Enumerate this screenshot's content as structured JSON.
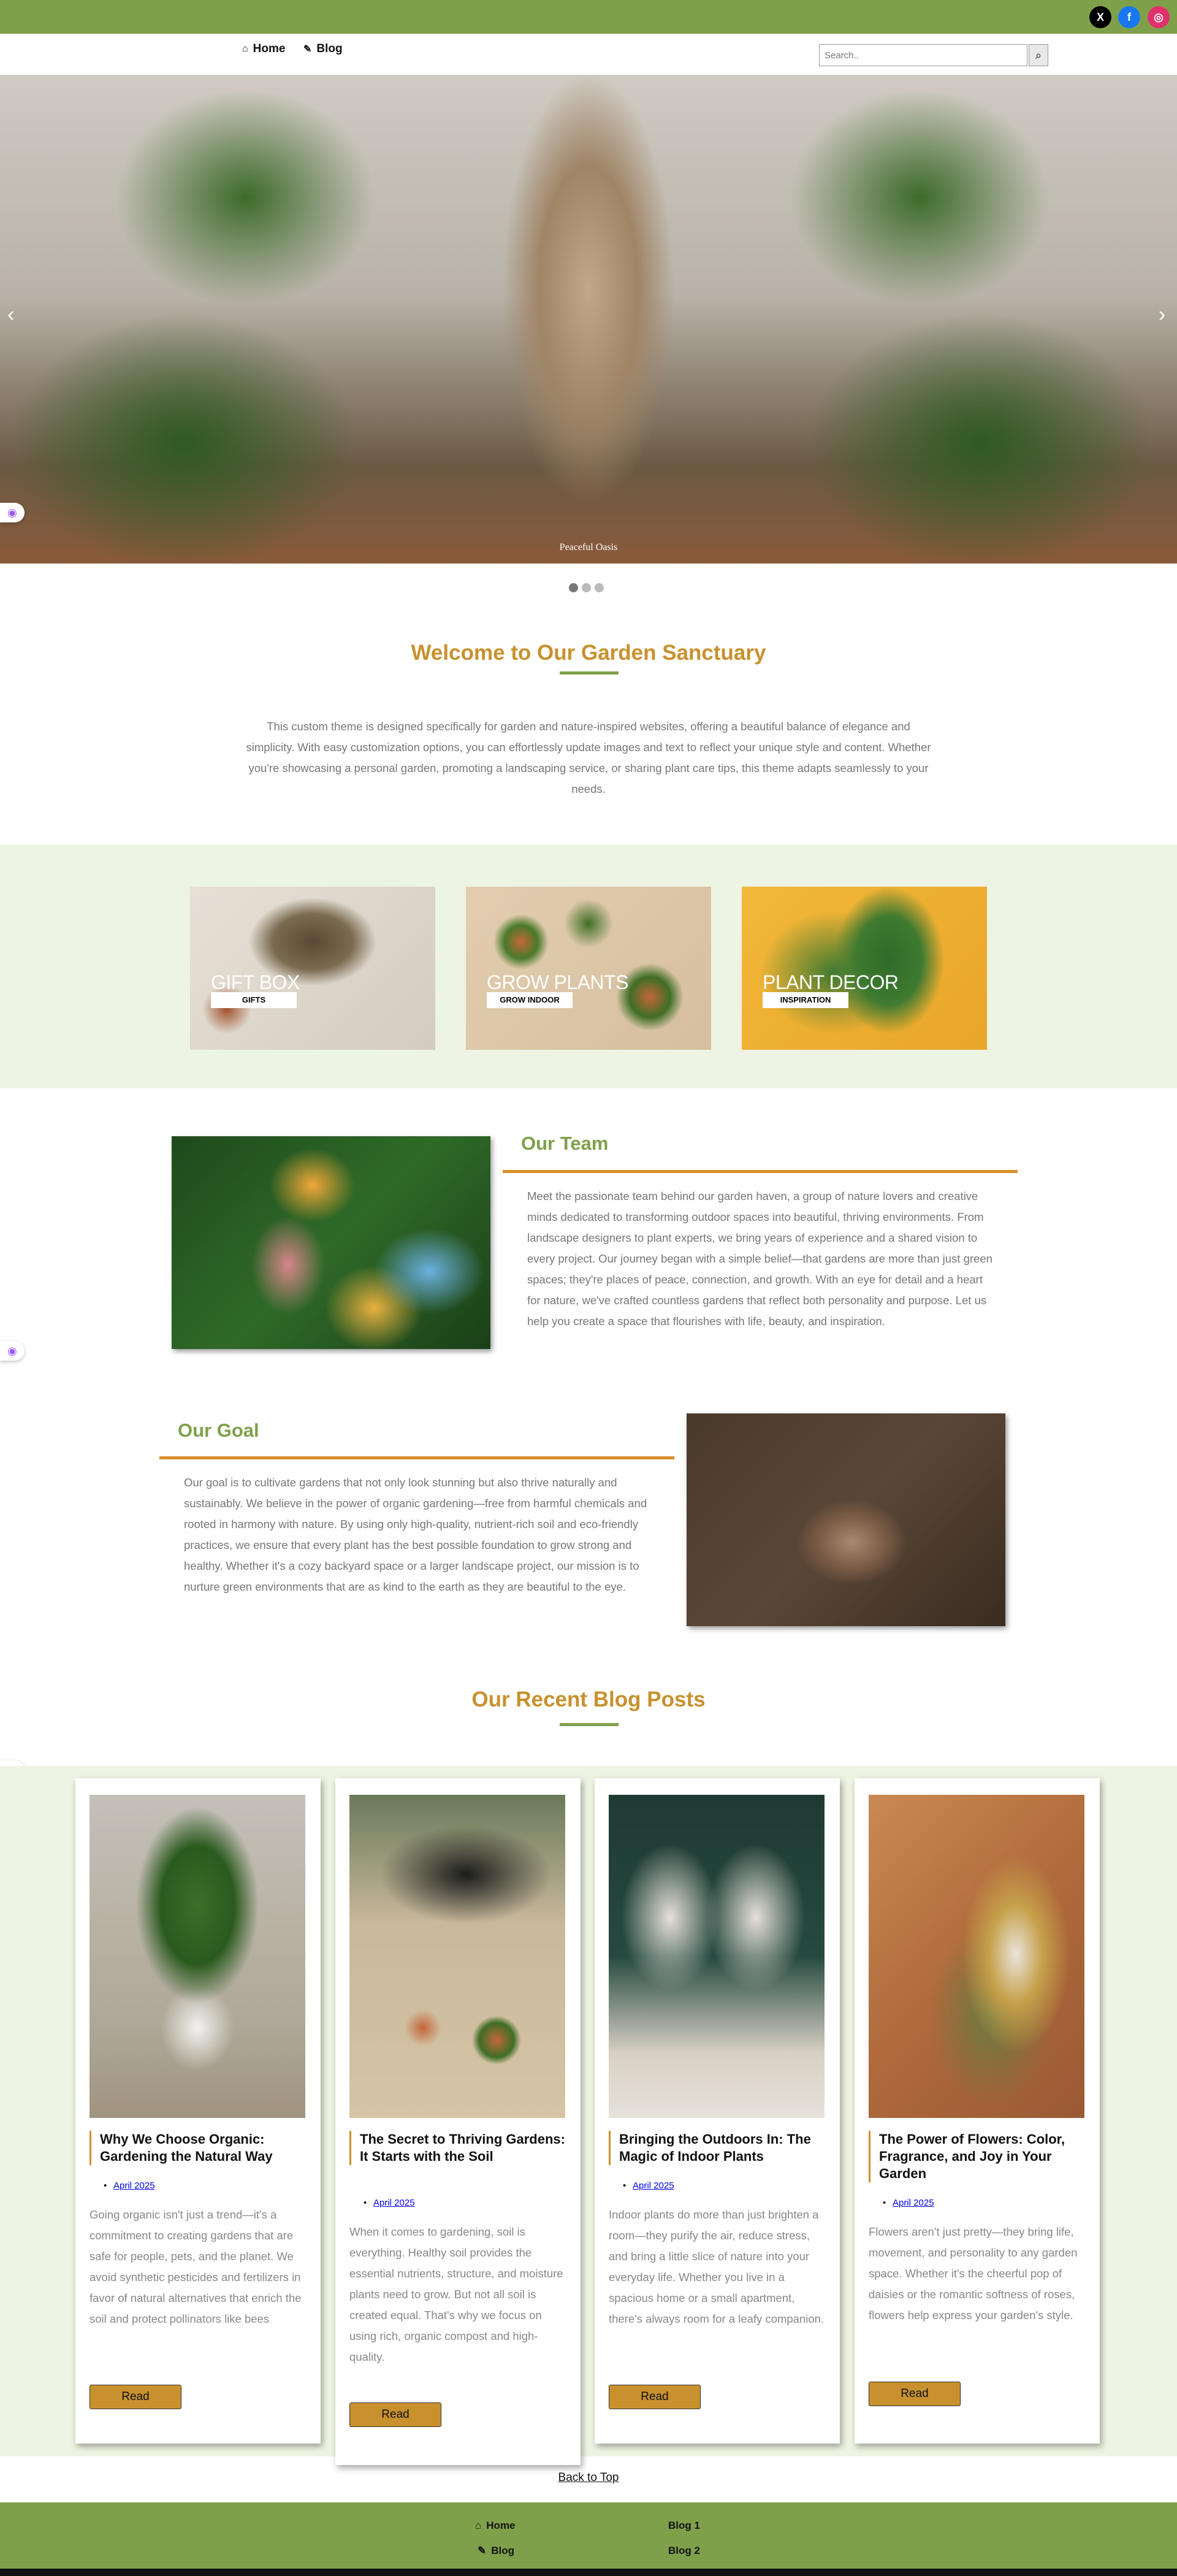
{
  "social": {
    "x": "X",
    "facebook": "f",
    "instagram": "◎"
  },
  "nav": {
    "home": "Home",
    "blog": "Blog",
    "home_icon": "⌂",
    "blog_icon": "✎"
  },
  "search": {
    "placeholder": "Search..",
    "icon": "⌕"
  },
  "hero": {
    "caption": "Peaceful Oasis",
    "prev": "‹",
    "next": "›"
  },
  "welcome": {
    "title": "Welcome to Our Garden Sanctuary",
    "text": "This custom theme is designed specifically for garden and nature-inspired websites, offering a beautiful balance of elegance and simplicity. With easy customization options, you can effortlessly update images and text to reflect your unique style and content. Whether you're showcasing a personal garden, promoting a landscaping service, or sharing plant care tips, this theme adapts seamlessly to your needs."
  },
  "categories": [
    {
      "title": "GIFT BOX",
      "subtitle": "GIFTS"
    },
    {
      "title": "GROW PLANTS",
      "subtitle": "GROW INDOOR"
    },
    {
      "title": "PLANT DECOR",
      "subtitle": "INSPIRATION"
    }
  ],
  "team": {
    "title": "Our Team",
    "text": "Meet the passionate team behind our garden haven, a group of nature lovers and creative minds dedicated to transforming outdoor spaces into beautiful, thriving environments. From landscape designers to plant experts, we bring years of experience and a shared vision to every project. Our journey began with a simple belief—that gardens are more than just green spaces; they're places of peace, connection, and growth. With an eye for detail and a heart for nature, we've crafted countless gardens that reflect both personality and purpose. Let us help you create a space that flourishes with life, beauty, and inspiration."
  },
  "goal": {
    "title": "Our Goal",
    "text": "Our goal is to cultivate gardens that not only look stunning but also thrive naturally and sustainably. We believe in the power of organic gardening—free from harmful chemicals and rooted in harmony with nature. By using only high-quality, nutrient-rich soil and eco-friendly practices, we ensure that every plant has the best possible foundation to grow strong and healthy. Whether it's a cozy backyard space or a larger landscape project, our mission is to nurture green environments that are as kind to the earth as they are beautiful to the eye."
  },
  "blog": {
    "title": "Our Recent Blog Posts",
    "read_label": "Read",
    "posts": [
      {
        "title": "Why We Choose Organic: Gardening the Natural Way",
        "date": "April 2025",
        "excerpt": "Going organic isn't just a trend—it's a commitment to creating gardens that are safe for people, pets, and the planet. We avoid synthetic pesticides and fertilizers in favor of natural alternatives that enrich the soil and protect pollinators like bees"
      },
      {
        "title": "The Secret to Thriving Gardens: It Starts with the Soil",
        "date": "April 2025",
        "excerpt": "When it comes to gardening, soil is everything. Healthy soil provides the essential nutrients, structure, and moisture plants need to grow. But not all soil is created equal. That's why we focus on using rich, organic compost and high-quality."
      },
      {
        "title": "Bringing the Outdoors In: The Magic of Indoor Plants",
        "date": "April 2025",
        "excerpt": "Indoor plants do more than just brighten a room—they purify the air, reduce stress, and bring a little slice of nature into your everyday life. Whether you live in a spacious home or a small apartment, there's always room for a leafy companion."
      },
      {
        "title": "The Power of Flowers: Color, Fragrance, and Joy in Your Garden",
        "date": "April 2025",
        "excerpt": "Flowers aren't just pretty—they bring life, movement, and personality to any garden space. Whether it's the cheerful pop of daisies or the romantic softness of roses, flowers help express your garden's style."
      }
    ]
  },
  "back_to_top": "Back to Top",
  "footer": {
    "home": "Home",
    "blog": "Blog",
    "blog1": "Blog 1",
    "blog2": "Blog 2"
  },
  "colors": {
    "accent_green": "#7fa04a",
    "accent_gold": "#c8912e",
    "band_bg": "#eef4e3"
  }
}
